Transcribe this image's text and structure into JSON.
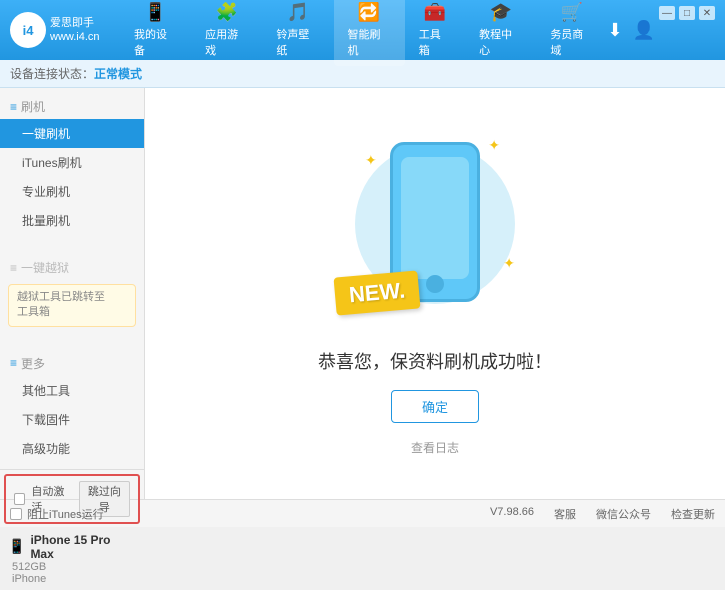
{
  "topbar": {
    "logo": {
      "circle_text": "i4",
      "line1": "爱思即手",
      "line2": "www.i4.cn"
    },
    "nav": [
      {
        "id": "my-device",
        "icon": "📱",
        "label": "我的设备"
      },
      {
        "id": "app-games",
        "icon": "🧩",
        "label": "应用游戏"
      },
      {
        "id": "ringtone",
        "icon": "🎵",
        "label": "铃声壁纸"
      },
      {
        "id": "smart-flash",
        "icon": "🔁",
        "label": "智能刷机",
        "active": true
      },
      {
        "id": "toolbox",
        "icon": "🧰",
        "label": "工具箱"
      },
      {
        "id": "tutorial",
        "icon": "🎓",
        "label": "教程中心"
      },
      {
        "id": "service",
        "icon": "🛒",
        "label": "务员商域"
      }
    ],
    "top_icons": {
      "download": "⬇",
      "user": "👤"
    },
    "win_controls": [
      "—",
      "□",
      "✕"
    ]
  },
  "statusbar": {
    "prefix": "设备连接状态：",
    "mode": "正常模式"
  },
  "sidebar": {
    "sections": [
      {
        "header": "刷机",
        "items": [
          {
            "id": "yijian-flash",
            "label": "一键刷机",
            "active": true
          },
          {
            "id": "itunes-flash",
            "label": "iTunes刷机",
            "active": false
          },
          {
            "id": "pro-flash",
            "label": "专业刷机",
            "active": false
          },
          {
            "id": "batch-flash",
            "label": "批量刷机",
            "active": false
          }
        ]
      },
      {
        "header": "一键越狱",
        "disabled": true,
        "note": "越狱工具已跳转至\n工具箱"
      },
      {
        "header": "更多",
        "items": [
          {
            "id": "other-tools",
            "label": "其他工具"
          },
          {
            "id": "download-firmware",
            "label": "下载固件"
          },
          {
            "id": "advanced",
            "label": "高级功能"
          }
        ]
      }
    ]
  },
  "device_panel": {
    "auto_activate_label": "自动激活",
    "skip_guide_label": "跳过向导",
    "device_name": "iPhone 15 Pro Max",
    "device_storage": "512GB",
    "device_type": "iPhone"
  },
  "bottom_sidebar": {
    "stop_itunes_label": "阻止iTunes运行"
  },
  "content": {
    "new_label": "NEW.",
    "success_text": "恭喜您，保资料刷机成功啦！",
    "confirm_button": "确定",
    "log_link": "查看日志"
  },
  "bottombar": {
    "version": "V7.98.66",
    "links": [
      "客服",
      "微信公众号",
      "检查更新"
    ]
  }
}
